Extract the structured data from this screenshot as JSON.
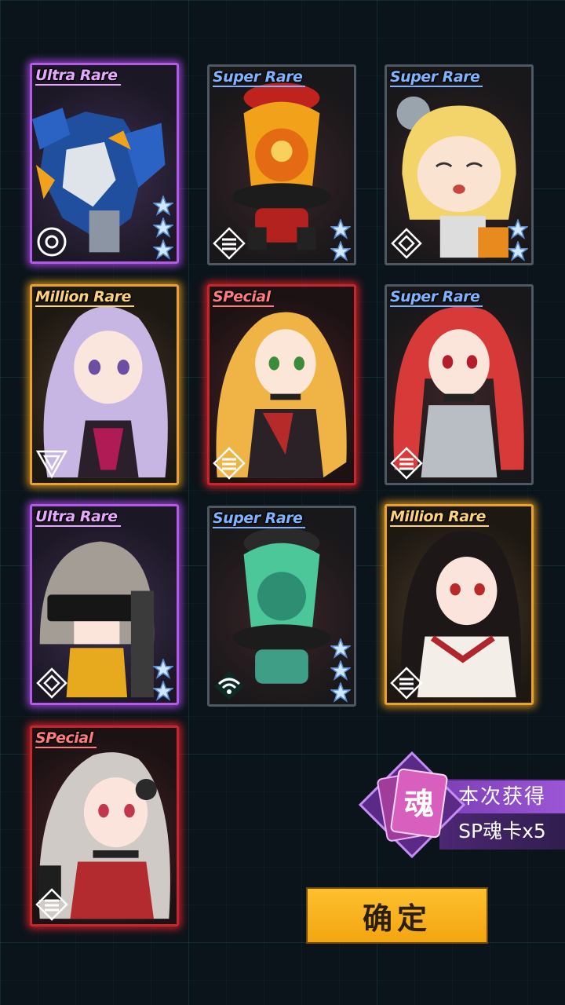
{
  "cards": [
    {
      "rarity": "Ultra Rare",
      "tier": "ur",
      "stars": 3,
      "faction": "ring-icon",
      "character": "blue-mech"
    },
    {
      "rarity": "Super Rare",
      "tier": "sr",
      "stars": 2,
      "faction": "stripe-badge-icon",
      "character": "orange-skull-capsule"
    },
    {
      "rarity": "Super Rare",
      "tier": "sr",
      "stars": 2,
      "faction": "diamond-icon",
      "character": "blonde-chibi"
    },
    {
      "rarity": "Million Rare",
      "tier": "mr",
      "stars": 0,
      "faction": "triangle-icon",
      "character": "lavender-hair-girl"
    },
    {
      "rarity": "SPecial",
      "tier": "sp",
      "stars": 0,
      "faction": "stripe-badge-icon",
      "character": "blonde-ponytail-girl"
    },
    {
      "rarity": "Super Rare",
      "tier": "sr",
      "stars": 0,
      "faction": "stripe-badge-icon",
      "character": "red-twintail-girl"
    },
    {
      "rarity": "Ultra Rare",
      "tier": "ur",
      "stars": 2,
      "faction": "diamond-icon",
      "character": "visor-chibi"
    },
    {
      "rarity": "Super Rare",
      "tier": "sr",
      "stars": 3,
      "faction": "wifi-icon",
      "character": "green-skull-capsule"
    },
    {
      "rarity": "Million Rare",
      "tier": "mr",
      "stars": 0,
      "faction": "stripe-badge-icon",
      "character": "black-hair-girl"
    },
    {
      "rarity": "SPecial",
      "tier": "sp",
      "stars": 0,
      "faction": "stripe-badge-icon",
      "character": "silver-hair-headphone-girl"
    }
  ],
  "reward": {
    "icon_char": "魂",
    "label": "本次获得",
    "value": "SP魂卡x5"
  },
  "confirm_label": "确定",
  "colors": {
    "ultra": "#b45ae8",
    "million": "#e9a32a",
    "special": "#c9262c",
    "super": "#4d5863",
    "button": "#f7b21f"
  }
}
